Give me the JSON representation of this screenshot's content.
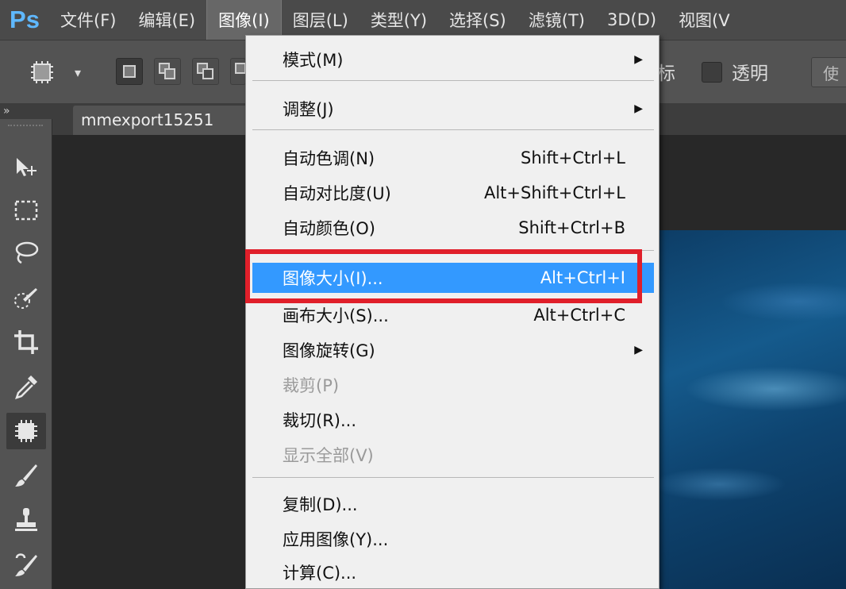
{
  "app": {
    "logo": "Ps"
  },
  "menubar": {
    "items": [
      {
        "label": "文件(F)"
      },
      {
        "label": "编辑(E)"
      },
      {
        "label": "图像(I)",
        "active": true
      },
      {
        "label": "图层(L)"
      },
      {
        "label": "类型(Y)"
      },
      {
        "label": "选择(S)"
      },
      {
        "label": "滤镜(T)"
      },
      {
        "label": "3D(D)"
      },
      {
        "label": "视图(V"
      }
    ]
  },
  "options_bar": {
    "tool_icon": "marquee-icon",
    "dropdown_arrow": "▾",
    "partial_label": "标",
    "transparent_label": "透明",
    "right_button_label": "使"
  },
  "document": {
    "tab_title": "mmexport15251 ",
    "collapse_glyph": "»"
  },
  "tools": [
    {
      "name": "move-icon"
    },
    {
      "name": "rect-marquee-icon"
    },
    {
      "name": "lasso-icon"
    },
    {
      "name": "quick-select-icon"
    },
    {
      "name": "crop-icon"
    },
    {
      "name": "eyedropper-icon"
    },
    {
      "name": "patch-icon",
      "selected": true
    },
    {
      "name": "brush-icon"
    },
    {
      "name": "clone-stamp-icon"
    },
    {
      "name": "history-brush-icon"
    }
  ],
  "image_menu": {
    "items": [
      {
        "label": "模式(M)",
        "shortcut": "",
        "submenu": true,
        "disabled": false
      },
      {
        "separator": true
      },
      {
        "label": "调整(J)",
        "shortcut": "",
        "submenu": true,
        "disabled": false
      },
      {
        "separator": true
      },
      {
        "label": "自动色调(N)",
        "shortcut": "Shift+Ctrl+L",
        "submenu": false,
        "disabled": false
      },
      {
        "label": "自动对比度(U)",
        "shortcut": "Alt+Shift+Ctrl+L",
        "submenu": false,
        "disabled": false
      },
      {
        "label": "自动颜色(O)",
        "shortcut": "Shift+Ctrl+B",
        "submenu": false,
        "disabled": false
      },
      {
        "separator": true
      },
      {
        "label": "图像大小(I)...",
        "shortcut": "Alt+Ctrl+I",
        "submenu": false,
        "disabled": false,
        "highlighted": true
      },
      {
        "label": "画布大小(S)...",
        "shortcut": "Alt+Ctrl+C",
        "submenu": false,
        "disabled": false
      },
      {
        "label": "图像旋转(G)",
        "shortcut": "",
        "submenu": true,
        "disabled": false
      },
      {
        "label": "裁剪(P)",
        "shortcut": "",
        "submenu": false,
        "disabled": true
      },
      {
        "label": "裁切(R)...",
        "shortcut": "",
        "submenu": false,
        "disabled": false
      },
      {
        "label": "显示全部(V)",
        "shortcut": "",
        "submenu": false,
        "disabled": true
      },
      {
        "separator": true
      },
      {
        "label": "复制(D)...",
        "shortcut": "",
        "submenu": false,
        "disabled": false
      },
      {
        "label": "应用图像(Y)...",
        "shortcut": "",
        "submenu": false,
        "disabled": false
      },
      {
        "label": "计算(C)...",
        "shortcut": "",
        "submenu": false,
        "disabled": false
      }
    ]
  },
  "colors": {
    "highlight": "#3399ff",
    "annotation_box": "#e01f2a",
    "menubar_bg": "#4a4a4a",
    "logo": "#5fb8ff"
  }
}
